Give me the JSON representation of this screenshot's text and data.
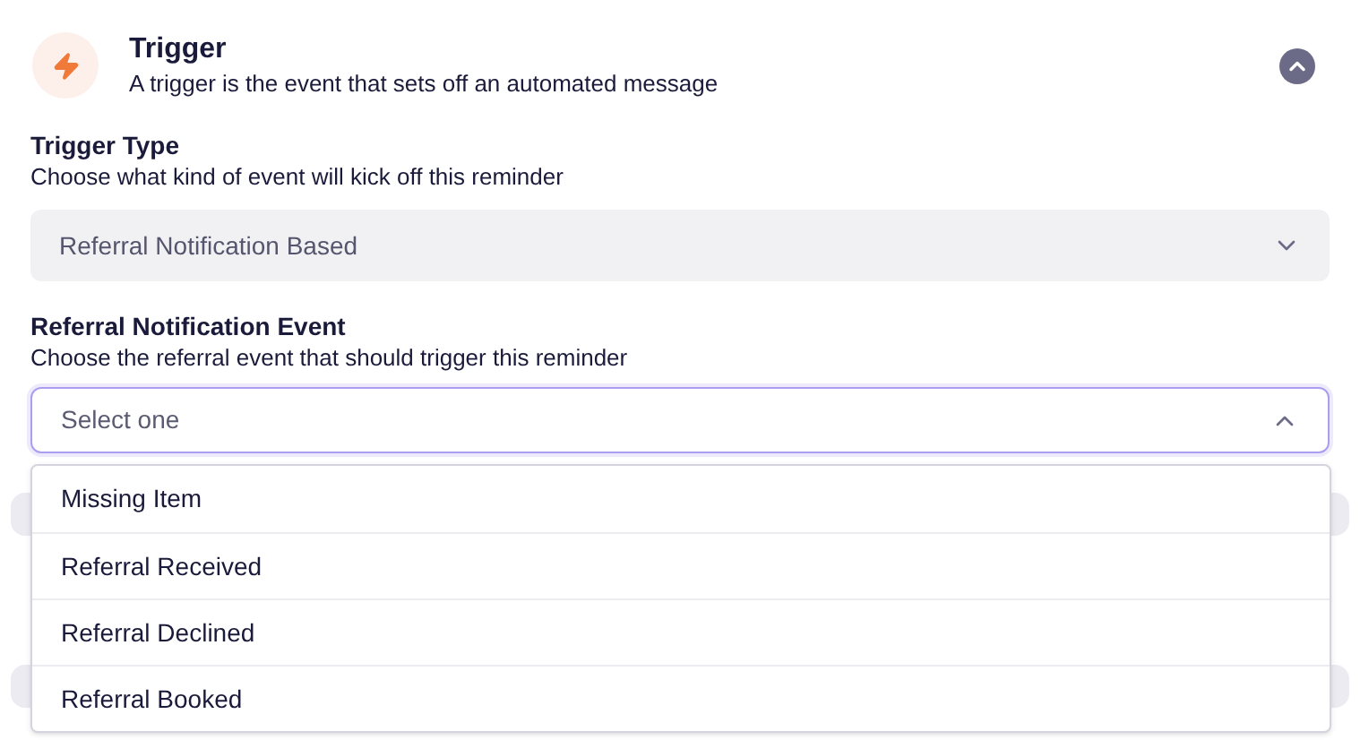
{
  "section": {
    "title": "Trigger",
    "description": "A trigger is the event that sets off an automated message",
    "expanded": true
  },
  "trigger_type": {
    "label": "Trigger Type",
    "description": "Choose what kind of event will kick off this reminder",
    "value": "Referral Notification Based"
  },
  "referral_event": {
    "label": "Referral Notification Event",
    "description": "Choose the referral event that should trigger this reminder",
    "placeholder": "Select one",
    "open": true,
    "options": [
      {
        "label": "Missing Item"
      },
      {
        "label": "Referral Received"
      },
      {
        "label": "Referral Declined"
      },
      {
        "label": "Referral Booked"
      }
    ]
  }
}
